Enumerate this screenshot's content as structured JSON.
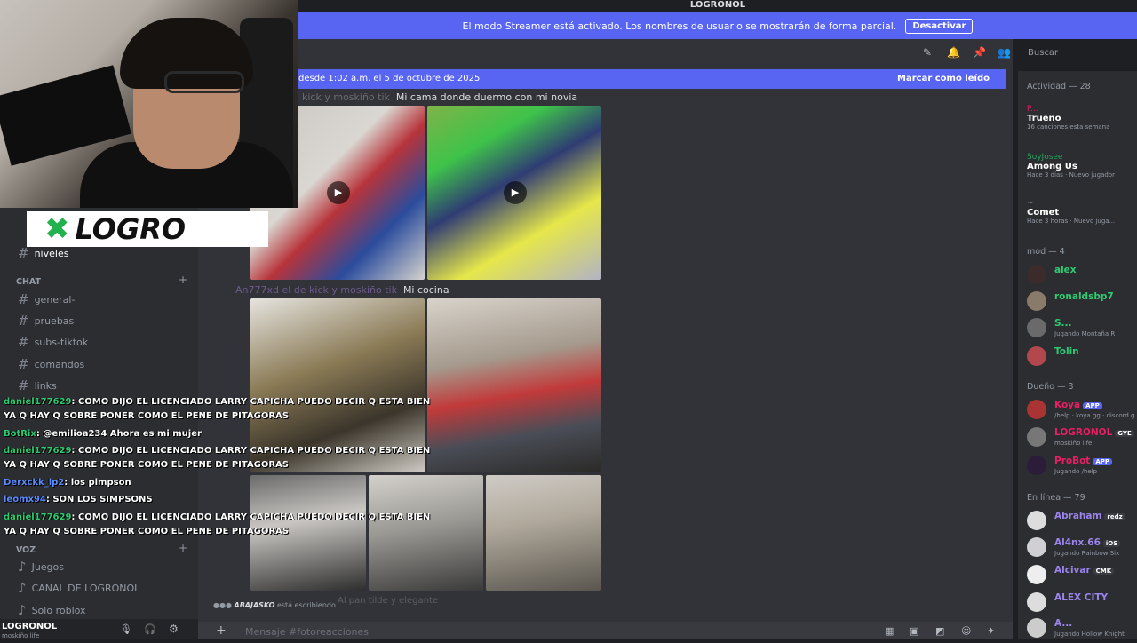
{
  "topbar": {
    "title": "LOGRONOL"
  },
  "banner": {
    "text": "El modo Streamer está activado. Los nombres de usuario se mostrarán de forma parcial.",
    "button": "Desactivar"
  },
  "overlay_logo": {
    "text": "LOGRO"
  },
  "search": {
    "placeholder": "Buscar"
  },
  "newbar": {
    "text": "desde 1:02 a.m. el 5 de octubre de 2025",
    "mark": "Marcar como leído"
  },
  "messages": [
    {
      "user": "kick y moskiño tik",
      "text": "Mi cama donde duermo con mi novia"
    },
    {
      "user": "An777xd el de kick y moskiño tik",
      "text": "Mi cocina"
    },
    {
      "user": "",
      "text": "Al pan tilde y elegante"
    }
  ],
  "typing": {
    "user": "ABAJASKO",
    "text": "está escribiendo..."
  },
  "input": {
    "placeholder": "Mensaje #fotoreacciones"
  },
  "sidebar": {
    "channels_top": [
      {
        "label": "niveles"
      }
    ],
    "chat_category": "CHAT",
    "chat_channels": [
      {
        "label": "general-"
      },
      {
        "label": "pruebas"
      },
      {
        "label": "subs-tiktok"
      },
      {
        "label": "comandos"
      },
      {
        "label": "links"
      }
    ],
    "voz_category": "VOZ",
    "voice_channels": [
      {
        "label": "Juegos"
      },
      {
        "label": "CANAL DE LOGRONOL"
      },
      {
        "label": "Solo roblox"
      }
    ],
    "user": {
      "name": "LOGRONOL",
      "status": "moskiño life"
    }
  },
  "chat_overlay": [
    {
      "user": "daniel177629",
      "text": ": COMO DIJO EL LICENCIADO LARRY CAPICHA PUEDO DECIR Q ESTA BIEN"
    },
    {
      "user": "",
      "text": "YA Q HAY Q SOBRE PONER COMO EL PENE DE PITAGORAS"
    },
    {
      "user": "BotRix",
      "text": ": @emilioa234 Ahora es mi mujer"
    },
    {
      "user": "daniel177629",
      "text": ": COMO DIJO EL LICENCIADO LARRY CAPICHA PUEDO DECIR Q ESTA BIEN"
    },
    {
      "user": "",
      "text": "YA Q HAY Q SOBRE PONER COMO EL PENE DE PITAGORAS"
    },
    {
      "user": "Derxckk_lp2",
      "text": ": los pimpson"
    },
    {
      "user": "leomx94",
      "text": ": SON LOS SIMPSONS"
    },
    {
      "user": "daniel177629",
      "text": ": COMO DIJO EL LICENCIADO LARRY CAPICHA PUEDO DECIR Q ESTA BIEN"
    },
    {
      "user": "",
      "text": "YA Q HAY Q SOBRE PONER COMO EL PENE DE PITAGORAS"
    }
  ],
  "members": {
    "activity_header": "Actividad — 28",
    "activities": [
      {
        "name": "P...",
        "game": "Trueno",
        "sub": "16 canciones esta semana"
      },
      {
        "name": "SoyJosee",
        "game": "Among Us",
        "sub": "Hace 3 días · Nuevo jugador"
      },
      {
        "name": "~",
        "game": "Comet",
        "sub": "Hace 3 horas · Nuevo juga..."
      }
    ],
    "mod_header": "mod — 4",
    "mods": [
      {
        "name": "alex",
        "sub": "",
        "color": "#2ecc71"
      },
      {
        "name": "ronaldsbp7",
        "sub": "",
        "color": "#2ecc71"
      },
      {
        "name": "S...",
        "sub": "Jugando Montaña R",
        "color": "#2ecc71"
      },
      {
        "name": "Tolin",
        "sub": "",
        "color": "#2ecc71"
      }
    ],
    "owner_header": "Dueño — 3",
    "owners": [
      {
        "name": "Koya",
        "tag": "APP",
        "sub": "/help · koya.gg · discord.g",
        "color": "#e91e63"
      },
      {
        "name": "LOGRONOL",
        "tag": "GYE",
        "sub": "moskiño life",
        "color": "#e91e63"
      },
      {
        "name": "ProBot",
        "tag": "APP",
        "sub": "Jugando /help",
        "color": "#e91e63"
      }
    ],
    "online_header": "En línea — 79",
    "online": [
      {
        "name": "Abraham",
        "tag": "redz",
        "sub": "",
        "color": "#9b84ec"
      },
      {
        "name": "Al4nx.66",
        "tag": "iOS",
        "sub": "Jugando Rainbow Six",
        "color": "#9b84ec"
      },
      {
        "name": "Alcivar",
        "tag": "CMK",
        "sub": "",
        "color": "#9b84ec"
      },
      {
        "name": "ALEX CITY",
        "tag": "",
        "sub": "",
        "color": "#9b84ec"
      },
      {
        "name": "A...",
        "tag": "",
        "sub": "Jugando Hollow Knight",
        "color": "#9b84ec"
      }
    ]
  },
  "colors": {
    "accent": "#5865f2",
    "bg": "#313338",
    "sidebar": "#2b2d31"
  }
}
